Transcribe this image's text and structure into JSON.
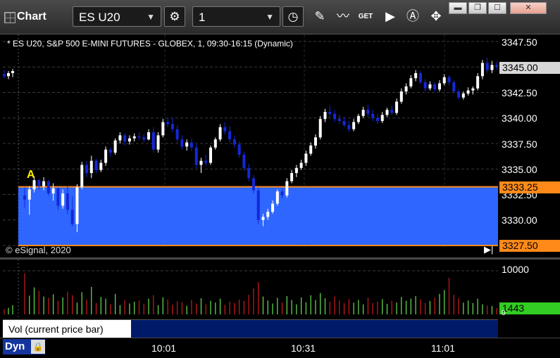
{
  "window": {
    "title": "Chart"
  },
  "toolbar": {
    "symbol": "ES U20",
    "interval": "1",
    "icons": [
      "settings-gear-icon",
      "clock-icon",
      "pencil-icon",
      "study-icon",
      "get-icon",
      "play-icon",
      "alert-icon",
      "expand-icon"
    ],
    "get_label": "GET"
  },
  "chart": {
    "symbol_line": "* ES U20, S&P 500 E-MINI FUTURES - GLOBEX, 1, 09:30-16:15 (Dynamic)",
    "copyright": "© eSignal, 2020",
    "marker": "A",
    "price_axis_labels": [
      "3347.50",
      "3342.50",
      "3340.00",
      "3337.50",
      "3335.00",
      "3332.50",
      "3330.00"
    ],
    "last_price": "3345.00",
    "zone_top_price": "3333.25",
    "zone_bottom_price": "3327.50",
    "volume_axis_label": "10000",
    "volume_last": "1443",
    "volume_zero": "0",
    "study_label": "Vol (current price bar)",
    "close_glyph": "x",
    "time_labels": [
      "10:01",
      "10:31",
      "11:01"
    ],
    "dyn_label": "Dyn",
    "colors": {
      "up": "#ffffff",
      "down": "#1428d8",
      "zone": "#2e66ff",
      "zone_line": "#ff8a1a",
      "vol_up": "#5fd24a",
      "vol_down": "#c0181c",
      "last_tag": "#d8d8d8",
      "vol_tag": "#33cc22"
    }
  },
  "chart_data": {
    "type": "candlestick",
    "price_ylim": [
      3327.5,
      3347.5
    ],
    "bars": [
      [
        3344.3,
        3344.7,
        3343.9,
        3344.1
      ],
      [
        3344.1,
        3344.6,
        3343.8,
        3344.4
      ],
      [
        3344.4,
        3344.8,
        3344.0,
        3344.6
      ],
      [
        3332.4,
        3333.2,
        3331.2,
        3332.0
      ],
      [
        3332.0,
        3333.3,
        3330.5,
        3333.0
      ],
      [
        3333.0,
        3334.3,
        3332.7,
        3333.9
      ],
      [
        3333.9,
        3334.0,
        3333.0,
        3333.3
      ],
      [
        3333.3,
        3334.2,
        3332.9,
        3333.8
      ],
      [
        3333.8,
        3333.9,
        3332.4,
        3332.6
      ],
      [
        3332.6,
        3333.6,
        3331.9,
        3333.1
      ],
      [
        3333.1,
        3333.2,
        3331.0,
        3331.4
      ],
      [
        3331.4,
        3333.0,
        3331.1,
        3332.6
      ],
      [
        3332.6,
        3333.3,
        3330.6,
        3331.0
      ],
      [
        3331.0,
        3332.3,
        3329.4,
        3329.6
      ],
      [
        3329.6,
        3333.5,
        3328.8,
        3333.2
      ],
      [
        3333.2,
        3335.7,
        3333.0,
        3335.4
      ],
      [
        3335.4,
        3335.8,
        3334.2,
        3334.6
      ],
      [
        3334.6,
        3336.3,
        3334.1,
        3335.8
      ],
      [
        3335.8,
        3336.0,
        3334.6,
        3334.9
      ],
      [
        3334.9,
        3335.9,
        3334.7,
        3335.6
      ],
      [
        3335.6,
        3337.2,
        3335.3,
        3336.9
      ],
      [
        3336.9,
        3337.1,
        3336.2,
        3336.6
      ],
      [
        3336.6,
        3338.0,
        3336.4,
        3337.8
      ],
      [
        3337.8,
        3338.6,
        3337.5,
        3338.3
      ],
      [
        3338.3,
        3338.5,
        3337.3,
        3337.7
      ],
      [
        3337.7,
        3338.3,
        3337.4,
        3338.0
      ],
      [
        3338.0,
        3338.5,
        3337.7,
        3338.2
      ],
      [
        3338.2,
        3338.6,
        3337.8,
        3338.1
      ],
      [
        3338.1,
        3338.4,
        3337.6,
        3337.9
      ],
      [
        3337.9,
        3338.9,
        3337.8,
        3338.6
      ],
      [
        3338.6,
        3339.1,
        3336.6,
        3336.9
      ],
      [
        3336.9,
        3338.6,
        3336.6,
        3338.3
      ],
      [
        3338.3,
        3339.9,
        3338.1,
        3339.6
      ],
      [
        3339.6,
        3340.0,
        3339.1,
        3339.4
      ],
      [
        3339.4,
        3340.0,
        3338.6,
        3338.9
      ],
      [
        3338.9,
        3339.3,
        3337.6,
        3337.9
      ],
      [
        3337.9,
        3338.3,
        3336.9,
        3337.2
      ],
      [
        3337.2,
        3337.9,
        3336.8,
        3337.6
      ],
      [
        3337.6,
        3338.0,
        3336.8,
        3337.1
      ],
      [
        3337.1,
        3337.4,
        3335.1,
        3335.4
      ],
      [
        3335.4,
        3336.1,
        3334.6,
        3335.8
      ],
      [
        3335.8,
        3336.4,
        3335.3,
        3335.6
      ],
      [
        3335.6,
        3337.3,
        3335.4,
        3337.1
      ],
      [
        3337.1,
        3338.1,
        3336.9,
        3337.9
      ],
      [
        3337.9,
        3339.4,
        3337.7,
        3339.1
      ],
      [
        3339.1,
        3339.6,
        3338.4,
        3338.7
      ],
      [
        3338.7,
        3339.2,
        3337.6,
        3337.9
      ],
      [
        3337.9,
        3338.3,
        3337.1,
        3337.4
      ],
      [
        3337.4,
        3337.7,
        3336.1,
        3336.4
      ],
      [
        3336.4,
        3336.7,
        3334.8,
        3335.1
      ],
      [
        3335.1,
        3335.5,
        3333.8,
        3334.1
      ],
      [
        3334.1,
        3334.4,
        3332.6,
        3332.9
      ],
      [
        3332.9,
        3333.2,
        3329.6,
        3330.0
      ],
      [
        3330.0,
        3330.6,
        3329.4,
        3330.3
      ],
      [
        3330.3,
        3331.1,
        3330.0,
        3330.8
      ],
      [
        3330.8,
        3331.9,
        3330.6,
        3331.6
      ],
      [
        3331.6,
        3333.0,
        3331.4,
        3332.8
      ],
      [
        3332.8,
        3333.1,
        3332.1,
        3332.4
      ],
      [
        3332.4,
        3334.1,
        3332.2,
        3333.8
      ],
      [
        3333.8,
        3334.9,
        3333.6,
        3334.6
      ],
      [
        3334.6,
        3335.4,
        3334.2,
        3335.1
      ],
      [
        3335.1,
        3335.9,
        3334.9,
        3335.6
      ],
      [
        3335.6,
        3336.8,
        3335.3,
        3336.5
      ],
      [
        3336.5,
        3337.6,
        3336.3,
        3337.3
      ],
      [
        3337.3,
        3338.4,
        3337.0,
        3338.1
      ],
      [
        3338.1,
        3340.2,
        3337.9,
        3339.9
      ],
      [
        3339.9,
        3340.9,
        3339.6,
        3340.6
      ],
      [
        3340.6,
        3341.2,
        3340.1,
        3340.4
      ],
      [
        3340.4,
        3340.8,
        3339.6,
        3339.9
      ],
      [
        3339.9,
        3340.3,
        3339.4,
        3339.7
      ],
      [
        3339.7,
        3340.1,
        3339.1,
        3339.3
      ],
      [
        3339.3,
        3339.7,
        3338.6,
        3338.9
      ],
      [
        3338.9,
        3339.9,
        3338.7,
        3339.6
      ],
      [
        3339.6,
        3340.4,
        3339.4,
        3340.2
      ],
      [
        3340.2,
        3341.1,
        3340.0,
        3340.8
      ],
      [
        3340.8,
        3341.3,
        3340.1,
        3340.4
      ],
      [
        3340.4,
        3340.8,
        3339.7,
        3340.0
      ],
      [
        3340.0,
        3340.4,
        3339.4,
        3339.7
      ],
      [
        3339.7,
        3340.6,
        3339.5,
        3340.3
      ],
      [
        3340.3,
        3341.0,
        3340.1,
        3340.8
      ],
      [
        3340.8,
        3341.2,
        3340.3,
        3340.5
      ],
      [
        3340.5,
        3341.9,
        3340.3,
        3341.6
      ],
      [
        3341.6,
        3342.9,
        3341.4,
        3342.6
      ],
      [
        3342.6,
        3343.4,
        3342.3,
        3343.1
      ],
      [
        3343.1,
        3344.2,
        3342.9,
        3343.9
      ],
      [
        3343.9,
        3344.7,
        3343.6,
        3344.4
      ],
      [
        3344.4,
        3344.6,
        3343.3,
        3343.5
      ],
      [
        3343.5,
        3343.8,
        3342.6,
        3342.9
      ],
      [
        3342.9,
        3343.6,
        3342.7,
        3343.3
      ],
      [
        3343.3,
        3343.5,
        3342.6,
        3342.8
      ],
      [
        3342.8,
        3343.7,
        3342.6,
        3343.4
      ],
      [
        3343.4,
        3344.3,
        3343.2,
        3344.0
      ],
      [
        3344.0,
        3344.2,
        3343.2,
        3343.5
      ],
      [
        3343.5,
        3343.7,
        3342.4,
        3342.6
      ],
      [
        3342.6,
        3342.8,
        3341.8,
        3342.0
      ],
      [
        3342.0,
        3342.6,
        3341.8,
        3342.4
      ],
      [
        3342.4,
        3343.0,
        3342.2,
        3342.7
      ],
      [
        3342.7,
        3343.1,
        3342.3,
        3342.9
      ],
      [
        3342.9,
        3344.4,
        3342.7,
        3344.1
      ],
      [
        3344.1,
        3345.7,
        3343.8,
        3345.4
      ],
      [
        3345.4,
        3345.9,
        3344.4,
        3344.7
      ],
      [
        3344.7,
        3345.6,
        3344.4,
        3345.2
      ],
      [
        3345.2,
        3345.5,
        3344.7,
        3345.0
      ]
    ],
    "volume": [
      1200,
      1500,
      2100,
      9400,
      4300,
      6200,
      5400,
      4100,
      3800,
      4600,
      3100,
      3900,
      5200,
      4400,
      2700,
      5100,
      3400,
      6300,
      2600,
      4000,
      3600,
      2300,
      4700,
      2100,
      3300,
      2500,
      2900,
      3200,
      2400,
      3600,
      4400,
      2100,
      3900,
      3400,
      2200,
      3000,
      2800,
      2000,
      3300,
      2500,
      3700,
      2300,
      3100,
      2700,
      3600,
      2200,
      2900,
      2600,
      3400,
      3100,
      4500,
      6000,
      7400,
      4100,
      3200,
      2500,
      3800,
      2700,
      4200,
      3300,
      2300,
      3900,
      2800,
      4400,
      3300,
      4900,
      3700,
      2900,
      4100,
      3200,
      2600,
      3500,
      2700,
      3300,
      2300,
      3800,
      2600,
      2900,
      3500,
      2400,
      3100,
      2700,
      4000,
      3100,
      3600,
      4200,
      3500,
      2600,
      3100,
      3800,
      4700,
      5600,
      8400,
      4500,
      3700,
      2700,
      3200,
      2600,
      3600,
      2300,
      2000,
      1900,
      1443
    ],
    "zone": [
      3327.5,
      3333.25
    ],
    "time_labels": [
      "10:01",
      "10:31",
      "11:01"
    ]
  }
}
